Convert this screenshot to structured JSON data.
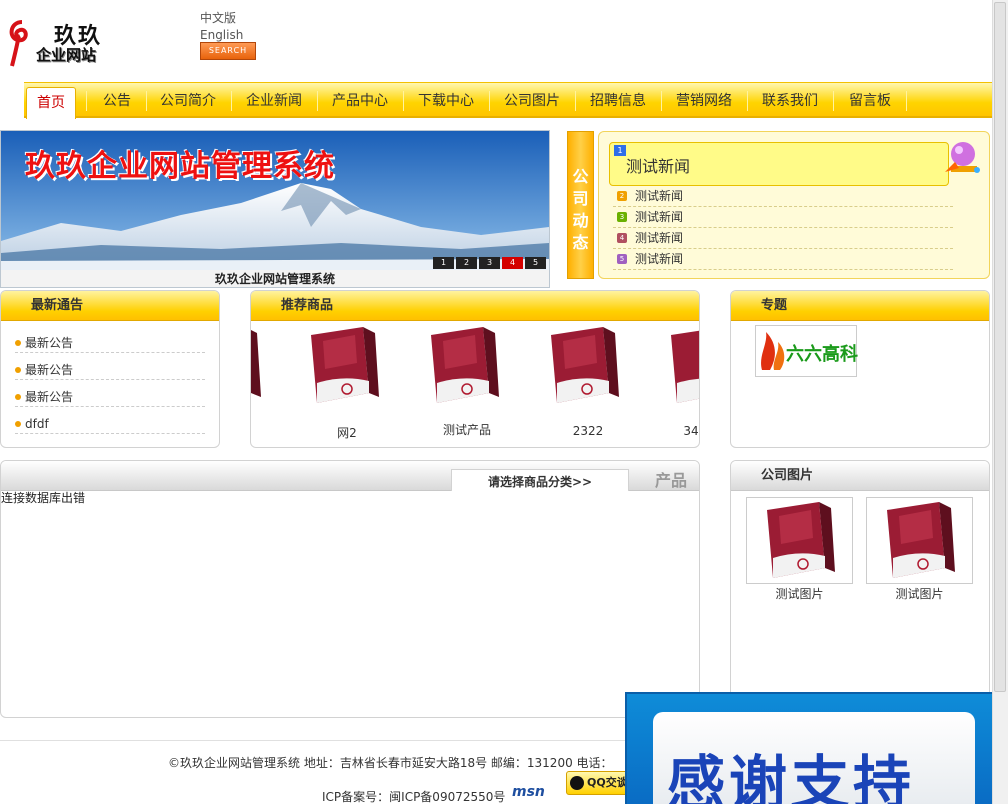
{
  "header": {
    "logo_line1": "玖玖",
    "logo_line2": "企业网站",
    "lang_cn": "中文版",
    "lang_en": "English",
    "search_label": "SEARCH"
  },
  "nav": {
    "items": [
      "首页",
      "公告",
      "公司简介",
      "企业新闻",
      "产品中心",
      "下载中心",
      "公司图片",
      "招聘信息",
      "营销网络",
      "联系我们",
      "留言板"
    ]
  },
  "banner": {
    "title": "玖玖企业网站管理系统",
    "caption": "玖玖企业网站管理系统",
    "slides": [
      "1",
      "2",
      "3",
      "4",
      "5"
    ],
    "active_slide": "4"
  },
  "company_news": {
    "tab_label": "公司动态",
    "head_badge": "1",
    "head_title": "测试新闻",
    "items": [
      {
        "num": "2",
        "title": "测试新闻",
        "color": "#f0a000"
      },
      {
        "num": "3",
        "title": "测试新闻",
        "color": "#6ab000"
      },
      {
        "num": "4",
        "title": "测试新闻",
        "color": "#b05060"
      },
      {
        "num": "5",
        "title": "测试新闻",
        "color": "#a060c0"
      }
    ]
  },
  "notices": {
    "title": "最新通告",
    "items": [
      "最新公告",
      "最新公告",
      "最新公告",
      "dfdf"
    ]
  },
  "recommended": {
    "title": "推荐商品",
    "items": [
      "网2",
      "测试产品",
      "2322",
      "34"
    ]
  },
  "special": {
    "title": "专题",
    "logo_text": "六六高科"
  },
  "products": {
    "category_tab": "请选择商品分类>>",
    "tag": "产品",
    "error": "连接数据库出错"
  },
  "company_pics": {
    "title": "公司图片",
    "items": [
      "测试图片",
      "测试图片"
    ]
  },
  "footer": {
    "line1": "©玖玖企业网站管理系统    地址：吉林省长春市延安大路18号    邮编：131200    电话：",
    "line2": "ICP备案号：闽ICP备09072550号",
    "msn": "msn",
    "qq": "QQ交谈"
  },
  "popup": {
    "text": "感谢支持"
  }
}
